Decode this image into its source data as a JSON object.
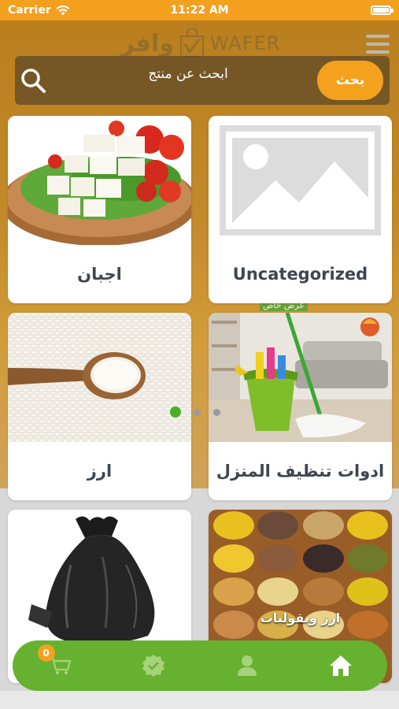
{
  "status_bar": {
    "carrier": "Carrier",
    "time": "11:22 AM"
  },
  "header": {
    "logo_arabic": "وافر",
    "logo_english": "WAFER",
    "menu_icon": "hamburger-menu-icon"
  },
  "search": {
    "placeholder": "ابحث عن منتج",
    "button_label": "بحث",
    "icon": "search-icon"
  },
  "banner": {
    "offer_text": "عرض خاص",
    "dots_count": 3,
    "active_dot": 0
  },
  "categories": [
    {
      "label": "Uncategorized",
      "image": "placeholder-image"
    },
    {
      "label": "اجبان",
      "image": "cheese-plate"
    },
    {
      "label": "ادوات تنظيف المنزل",
      "image": "cleaning-tools"
    },
    {
      "label": "ارز",
      "image": "rice-spoon"
    },
    {
      "label": "ارز وبقوليات",
      "image": "grains-legumes"
    },
    {
      "label": "",
      "image": "black-trash-bag"
    }
  ],
  "bottom_nav": {
    "cart_count": "0",
    "items": [
      {
        "icon": "cart-icon"
      },
      {
        "icon": "verified-badge-icon"
      },
      {
        "icon": "user-icon"
      },
      {
        "icon": "home-icon"
      }
    ]
  },
  "colors": {
    "accent_orange": "#f4a11d",
    "nav_green": "#66b12f",
    "label_text": "#3f4650"
  }
}
